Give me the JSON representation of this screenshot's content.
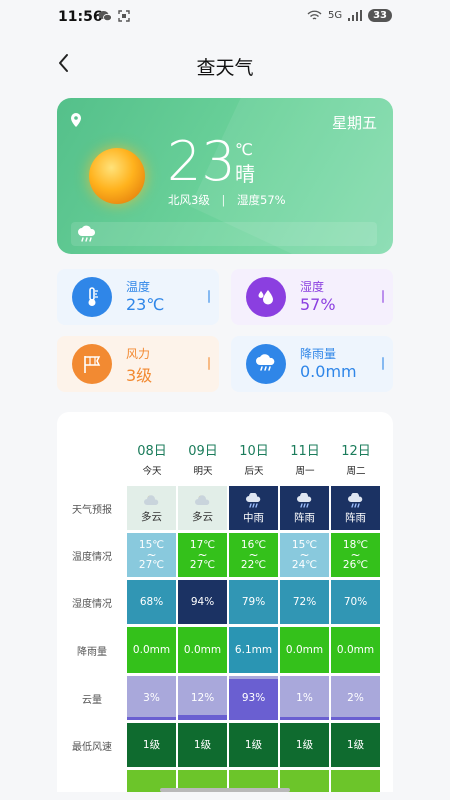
{
  "status_bar": {
    "time": "11:56",
    "signal": "5G",
    "battery": "33"
  },
  "nav": {
    "title": "查天气"
  },
  "hero": {
    "weekday": "星期五",
    "temperature": "23",
    "unit": "℃",
    "condition": "晴",
    "wind": "北风3级",
    "separator": "|",
    "humidity": "湿度57%"
  },
  "cards": [
    {
      "label": "温度",
      "value": "23℃",
      "icon": "thermometer-icon",
      "color": "#2f86e8",
      "bg": "#eef5fd"
    },
    {
      "label": "湿度",
      "value": "57%",
      "icon": "water-drop-icon",
      "color": "#8b3fe0",
      "bg": "#f5f0fd"
    },
    {
      "label": "风力",
      "value": "3级",
      "icon": "windsock-icon",
      "color": "#f28a32",
      "bg": "#fdf3ea"
    },
    {
      "label": "降雨量",
      "value": "0.0mm",
      "icon": "rain-cloud-icon",
      "color": "#2f86e8",
      "bg": "#eef5fd"
    }
  ],
  "forecast": {
    "row_labels": [
      "天气预报",
      "温度情况",
      "湿度情况",
      "降雨量",
      "云量",
      "最低风速"
    ],
    "days": [
      {
        "date": "08日",
        "day": "今天",
        "weather": "多云",
        "temp_high": "15℃",
        "temp_low": "27℃",
        "humidity": "68%",
        "rain": "0.0mm",
        "cloud": "3%",
        "cloud_pct": 3,
        "wind": "1级"
      },
      {
        "date": "09日",
        "day": "明天",
        "weather": "多云",
        "temp_high": "17℃",
        "temp_low": "27℃",
        "humidity": "94%",
        "rain": "0.0mm",
        "cloud": "12%",
        "cloud_pct": 12,
        "wind": "1级"
      },
      {
        "date": "10日",
        "day": "后天",
        "weather": "中雨",
        "temp_high": "16℃",
        "temp_low": "22℃",
        "humidity": "79%",
        "rain": "6.1mm",
        "cloud": "93%",
        "cloud_pct": 93,
        "wind": "1级"
      },
      {
        "date": "11日",
        "day": "周一",
        "weather": "阵雨",
        "temp_high": "15℃",
        "temp_low": "24℃",
        "humidity": "72%",
        "rain": "0.0mm",
        "cloud": "1%",
        "cloud_pct": 1,
        "wind": "1级"
      },
      {
        "date": "12日",
        "day": "周二",
        "weather": "阵雨",
        "temp_high": "18℃",
        "temp_low": "26℃",
        "humidity": "70%",
        "rain": "0.0mm",
        "cloud": "2%",
        "cloud_pct": 2,
        "wind": "1级"
      }
    ],
    "colors": {
      "weather_light": "#e2eee8",
      "weather_dark": "#1b3263",
      "temp_cool": "#89c9dd",
      "temp_green": "#34c11b",
      "humidity_mid": "#3196b4",
      "humidity_dark": "#1b3263",
      "rain_green": "#34c11b",
      "rain_teal": "#2a95b3",
      "cloud_light": "#a9a8db",
      "cloud_dark": "#6a5fd1",
      "wind": "#0f6b2f",
      "extra_row": "#6cc52a"
    }
  }
}
